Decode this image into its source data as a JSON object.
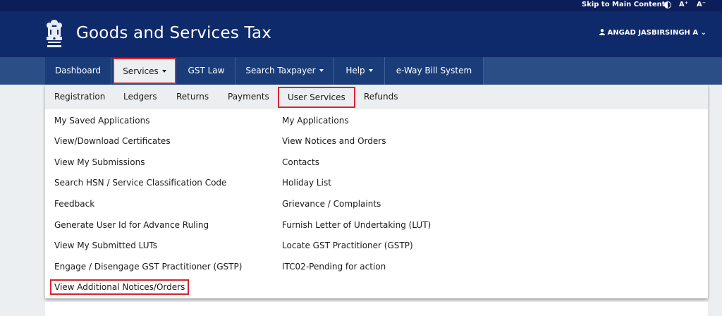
{
  "topbar": {
    "skip_link": "Skip to Main Content",
    "font_increase": "A⁺",
    "font_decrease": "A⁻",
    "contrast_icon": "contrast-icon"
  },
  "header": {
    "title": "Goods and Services Tax",
    "user_name": "ANGAD JASBIRSINGH A",
    "user_caret": "⌄",
    "emblem": "emblem-of-india-logo"
  },
  "nav": {
    "items": [
      {
        "label": "Dashboard"
      },
      {
        "label": "Services"
      },
      {
        "label": "GST Law"
      },
      {
        "label": "Search Taxpayer"
      },
      {
        "label": "Help"
      },
      {
        "label": "e-Way Bill System"
      }
    ]
  },
  "subtabs": [
    {
      "label": "Registration"
    },
    {
      "label": "Ledgers"
    },
    {
      "label": "Returns"
    },
    {
      "label": "Payments"
    },
    {
      "label": "User Services"
    },
    {
      "label": "Refunds"
    }
  ],
  "menu": {
    "left": [
      "My Saved Applications",
      "View/Download Certificates",
      "View My Submissions",
      "Search HSN / Service Classification Code",
      "Feedback",
      "Generate User Id for Advance Ruling",
      "View My Submitted LUTs",
      "Engage / Disengage GST Practitioner (GSTP)",
      "View Additional Notices/Orders"
    ],
    "right": [
      "My Applications",
      "View Notices and Orders",
      "Contacts",
      "Holiday List",
      "Grievance / Complaints",
      "Furnish Letter of Undertaking (LUT)",
      "Locate GST Practitioner (GSTP)",
      "ITC02-Pending for action"
    ]
  },
  "colors": {
    "topbar": "#0b1e59",
    "header": "#0f2a6b",
    "nav": "#1a3d7a",
    "highlight": "#d9232f"
  }
}
